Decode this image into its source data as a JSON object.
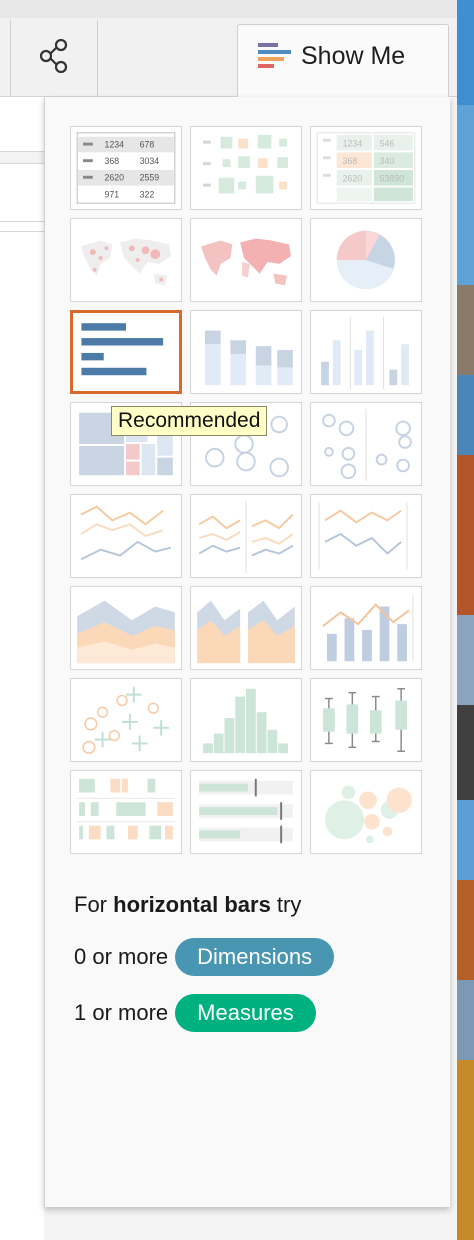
{
  "toolbar": {
    "share_icon": "share-icon",
    "show_me_label": "Show Me"
  },
  "thumbnails": [
    {
      "name": "text-table"
    },
    {
      "name": "symbol-map-highlight-table"
    },
    {
      "name": "highlight-table"
    },
    {
      "name": "symbol-map"
    },
    {
      "name": "filled-map"
    },
    {
      "name": "pie-chart"
    },
    {
      "name": "horizontal-bars",
      "selected": true
    },
    {
      "name": "stacked-bars"
    },
    {
      "name": "side-by-side-bars"
    },
    {
      "name": "treemap"
    },
    {
      "name": "circle-views"
    },
    {
      "name": "side-by-side-circles"
    },
    {
      "name": "lines-continuous"
    },
    {
      "name": "lines-discrete"
    },
    {
      "name": "dual-lines"
    },
    {
      "name": "area-continuous"
    },
    {
      "name": "area-discrete"
    },
    {
      "name": "dual-combination"
    },
    {
      "name": "scatter-plot"
    },
    {
      "name": "histogram"
    },
    {
      "name": "box-and-whisker"
    },
    {
      "name": "gantt-chart"
    },
    {
      "name": "bullet-graph"
    },
    {
      "name": "packed-bubbles"
    }
  ],
  "table_thumb": {
    "rows": [
      [
        "1234",
        "678"
      ],
      [
        "368",
        "3034"
      ],
      [
        "2620",
        "2559"
      ],
      [
        "971",
        "322"
      ]
    ]
  },
  "highlight_thumb": {
    "rows": [
      [
        "1234",
        "546"
      ],
      [
        "368",
        "340"
      ],
      [
        "2620",
        "53890"
      ]
    ]
  },
  "tooltip": "Recommended",
  "hint": {
    "prefix": "For ",
    "bold": "horizontal bars",
    "suffix": " try"
  },
  "requirements": {
    "dimensions_count": "0 or more",
    "dimensions_label": "Dimensions",
    "measures_count": "1 or more",
    "measures_label": "Measures"
  },
  "colors": {
    "selected_border": "#d96a2b",
    "dimensions_pill": "#4996b2",
    "measures_pill": "#00b180",
    "tooltip_bg": "#ffffc6"
  }
}
